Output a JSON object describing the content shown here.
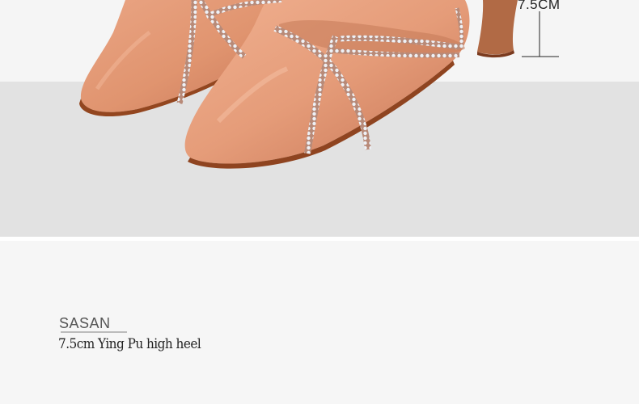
{
  "product_image": {
    "heel_height_label": "7.5CM",
    "brand_logo": "SASAN",
    "caption": "7.5cm Ying Pu high heel",
    "colors": {
      "satin": "#e39a78",
      "satin_shadow": "#c57656",
      "sole": "#9a4b27",
      "rhinestone": "#e8ecf2"
    }
  }
}
